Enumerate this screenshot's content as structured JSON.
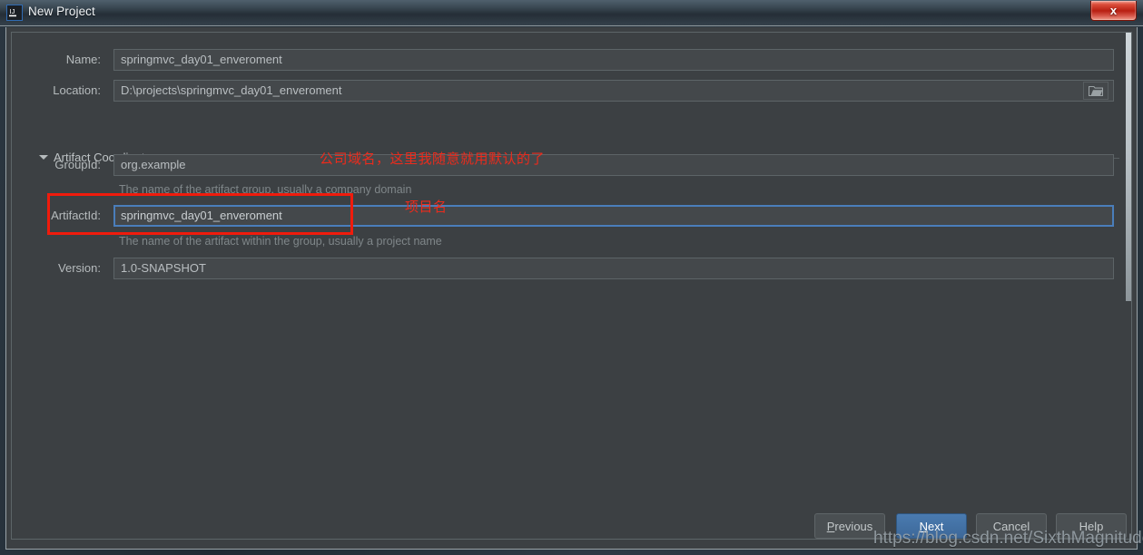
{
  "window": {
    "title": "New Project",
    "app_icon": "intellij-idea-icon",
    "close_label": "x"
  },
  "form": {
    "rows": [
      {
        "label": "Name:",
        "value": "springmvc_day01_enveroment",
        "hint": ""
      },
      {
        "label": "Location:",
        "value": "D:\\projects\\springmvc_day01_enveroment",
        "hint": ""
      }
    ],
    "section": {
      "title": "Artifact Coordinates",
      "expanded": true
    },
    "coords": [
      {
        "label": "GroupId:",
        "value": "org.example",
        "hint": "The name of the artifact group, usually a company domain",
        "focused": false
      },
      {
        "label": "ArtifactId:",
        "value": "springmvc_day01_enveroment",
        "hint": "The name of the artifact within the group, usually a project name",
        "focused": true
      },
      {
        "label": "Version:",
        "value": "1.0-SNAPSHOT",
        "hint": "",
        "focused": false
      }
    ],
    "browse_icon": "folder-icon"
  },
  "annotations": [
    {
      "text": "公司域名，这里我随意就用默认的了"
    },
    {
      "text": "项目名"
    }
  ],
  "footer": {
    "buttons": [
      {
        "label": "Previous",
        "mnemonic": "P",
        "primary": false
      },
      {
        "label": "Next",
        "mnemonic": "N",
        "primary": true
      },
      {
        "label": "Cancel",
        "mnemonic": "",
        "primary": false
      },
      {
        "label": "Help",
        "mnemonic": "",
        "primary": false
      }
    ]
  },
  "watermark": {
    "text": "https://blog.csdn.net/SixthMagnitude"
  },
  "colors": {
    "dialog_bg": "#3c4043",
    "field_bg": "#44484b",
    "accent_blue": "#4a7ebb",
    "annotation_red": "#ec2b1c",
    "close_red": "#b81f12"
  }
}
